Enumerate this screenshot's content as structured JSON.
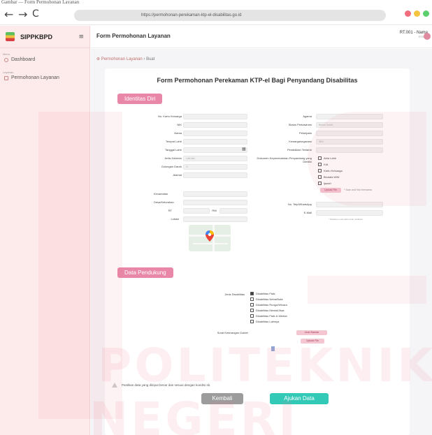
{
  "caption": "Gambar — Form Permohonan Layanan",
  "browser": {
    "back": "←",
    "forward": "→",
    "reload": "C",
    "url": "https://permohonan-perekaman-ktp-el-disabilitas.go.id",
    "dot_colors": [
      "#f26d7d",
      "#f5c542",
      "#5ccf6e"
    ]
  },
  "sidebar": {
    "brand": "SIPPKBPD",
    "menu_icon": "hamburger-icon",
    "section1": "Menu",
    "dashboard": "Dashboard",
    "section2": "Layanan",
    "layanan": "Permohonan Layanan"
  },
  "header": {
    "title": "Form Permohonan Layanan",
    "user_name": "RT.001 - Nama",
    "user_role": "RT/RW"
  },
  "breadcrumb": {
    "parent": "Permohonan Layanan",
    "sep": " › ",
    "current": "Buat"
  },
  "form": {
    "title": "Form Permohonan Perekaman KTP-el Bagi Penyandang Disabilitas",
    "section_identity": "Identitas Diri",
    "section_support": "Data Pendukung",
    "left_labels": {
      "kk": "No. Kartu Keluarga",
      "nik": "NIK",
      "nama": "Nama",
      "tempat": "Tempat Lahir",
      "tanggal": "Tanggal Lahir",
      "jk": "Jenis Kelamin",
      "goldar": "Golongan Darah",
      "alamat": "Alamat"
    },
    "jk_value": "Laki-laki",
    "goldar_value": "O",
    "address_fields": {
      "kec": "Kecamatan",
      "kel": "Desa/Kelurahan",
      "rt": "RT",
      "rw": "RW",
      "lokasi": "Lokasi"
    },
    "right_labels": {
      "agama": "Agama",
      "status": "Status Perkawinan",
      "pekerjaan": "Pekerjaan",
      "kewarganegaraan": "Kewarganegaraan",
      "pendidikan": "Pendidikan Terakhir",
      "dokumen": "Dokumen Kependudukan Penyandang yang Dimiliki",
      "hp": "No. Telp/WhatsApp",
      "email": "E-Mail"
    },
    "status_value": "Belum Kawin",
    "warga_value": "WNI",
    "docs": [
      "Akta Lahir",
      "KIA",
      "Kartu Keluarga",
      "Biodata WNI",
      "Ijazah"
    ],
    "upload_label": "Upload File",
    "upload_hint": "* Scan asli/ foto berwarna",
    "email_hint": "* Pastikan email aktif untuk notifikasi",
    "disability_label": "Jenis Disabilitas",
    "disabilities": [
      "Disabilitas Fisik",
      "Disabilitas Netra/Buta",
      "Disabilitas Rungu/Wicara",
      "Disabilitas Mental/Jiwa",
      "Disabilitas Fisik & Mental",
      "Disabilitas Lainnya"
    ],
    "surat_label": "Surat Keterangan Dokter",
    "surat_btn": "Lihat Standar",
    "surat_upload": "Upload File",
    "agreement": "Pastikan data yang diinput benar dan sesuai dengan kondisi sb.",
    "back_btn": "Kembali",
    "submit_btn": "Ajukan Data"
  },
  "watermark": {
    "line1": "POLITEKNIK",
    "line2": "NEGERI"
  },
  "colors": {
    "accent": "#e987a8",
    "submit": "#33c9b7",
    "back": "#9c9c9c"
  }
}
